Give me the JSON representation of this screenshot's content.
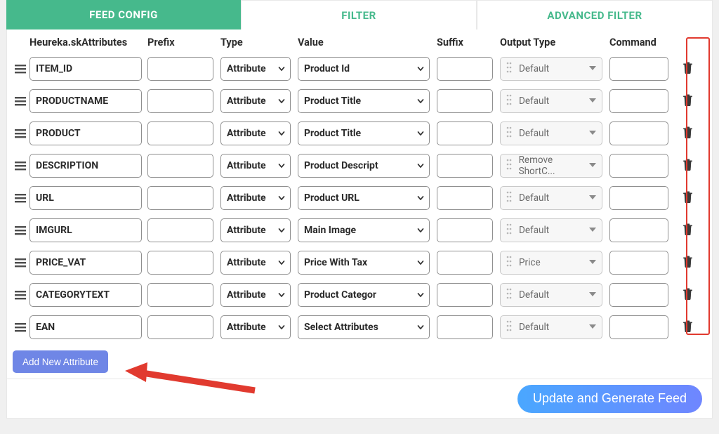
{
  "tabs": {
    "config": "FEED CONFIG",
    "filter": "FILTER",
    "advanced": "ADVANCED FILTER"
  },
  "headers": {
    "attr": "Heureka.skAttributes",
    "prefix": "Prefix",
    "type": "Type",
    "value": "Value",
    "suffix": "Suffix",
    "otype": "Output Type",
    "cmd": "Command"
  },
  "rows": [
    {
      "attr": "ITEM_ID",
      "prefix": "",
      "type": "Attribute",
      "value": "Product Id",
      "suffix": "",
      "otype": "Default",
      "cmd": ""
    },
    {
      "attr": "PRODUCTNAME",
      "prefix": "",
      "type": "Attribute",
      "value": "Product Title",
      "suffix": "",
      "otype": "Default",
      "cmd": ""
    },
    {
      "attr": "PRODUCT",
      "prefix": "",
      "type": "Attribute",
      "value": "Product Title",
      "suffix": "",
      "otype": "Default",
      "cmd": ""
    },
    {
      "attr": "DESCRIPTION",
      "prefix": "",
      "type": "Attribute",
      "value": "Product Descript",
      "suffix": "",
      "otype": "Remove ShortC...",
      "cmd": ""
    },
    {
      "attr": "URL",
      "prefix": "",
      "type": "Attribute",
      "value": "Product URL",
      "suffix": "",
      "otype": "Default",
      "cmd": ""
    },
    {
      "attr": "IMGURL",
      "prefix": "",
      "type": "Attribute",
      "value": "Main Image",
      "suffix": "",
      "otype": "Default",
      "cmd": ""
    },
    {
      "attr": "PRICE_VAT",
      "prefix": "",
      "type": "Attribute",
      "value": "Price With Tax",
      "suffix": "",
      "otype": "Price",
      "cmd": ""
    },
    {
      "attr": "CATEGORYTEXT",
      "prefix": "",
      "type": "Attribute",
      "value": "Product Categor",
      "suffix": "",
      "otype": "Default",
      "cmd": ""
    },
    {
      "attr": "EAN",
      "prefix": "",
      "type": "Attribute",
      "value": "Select Attributes",
      "suffix": "",
      "otype": "Default",
      "cmd": ""
    }
  ],
  "buttons": {
    "add": "Add New Attribute",
    "generate": "Update and Generate Feed"
  }
}
